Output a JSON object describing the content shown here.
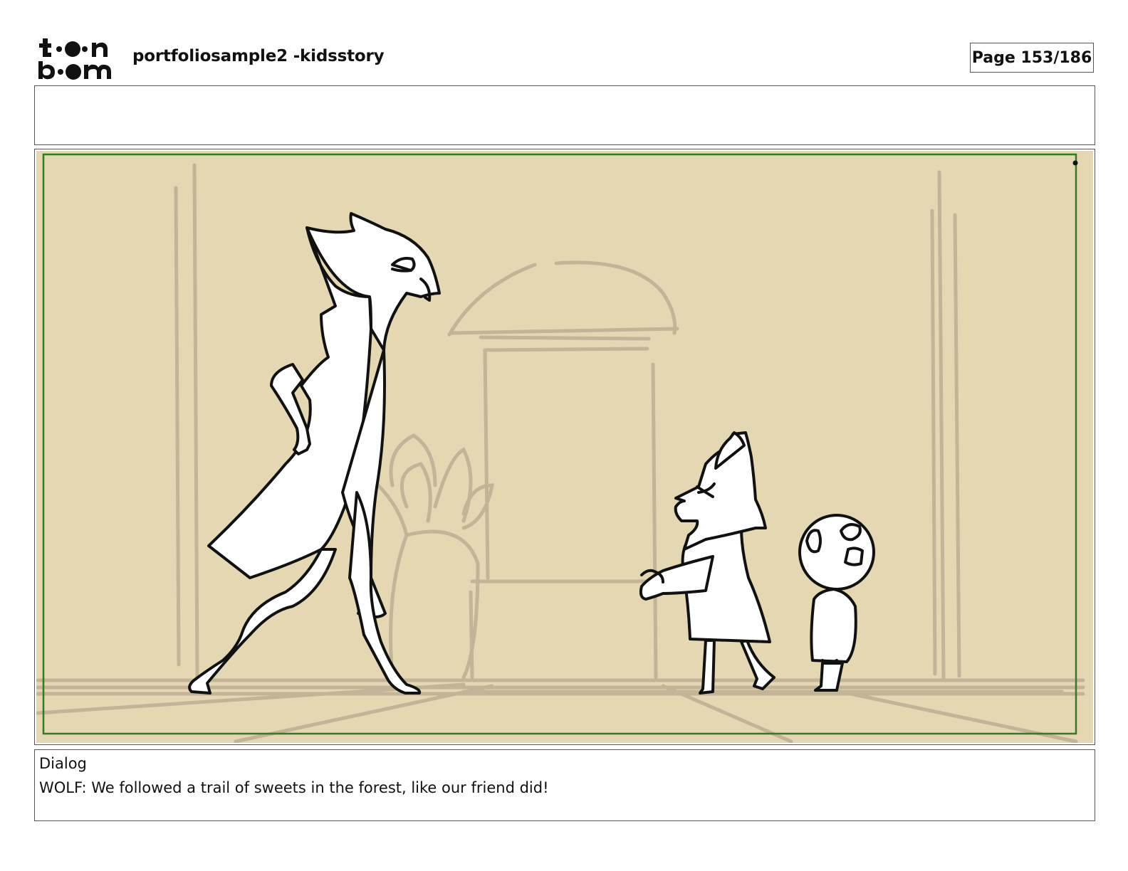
{
  "header": {
    "logo_text": "toon boom",
    "document_title": "portfoliosample2 -kidsstory",
    "page_indicator": "Page 153/186"
  },
  "panel": {
    "background_color": "#e3d7b4",
    "safe_frame_color": "#2e7d1f",
    "sketch_bg_color": "#c2b497",
    "line_color": "#111111"
  },
  "dialog": {
    "label": "Dialog",
    "text": "WOLF: We followed a trail of sweets in the forest, like our friend did!"
  }
}
